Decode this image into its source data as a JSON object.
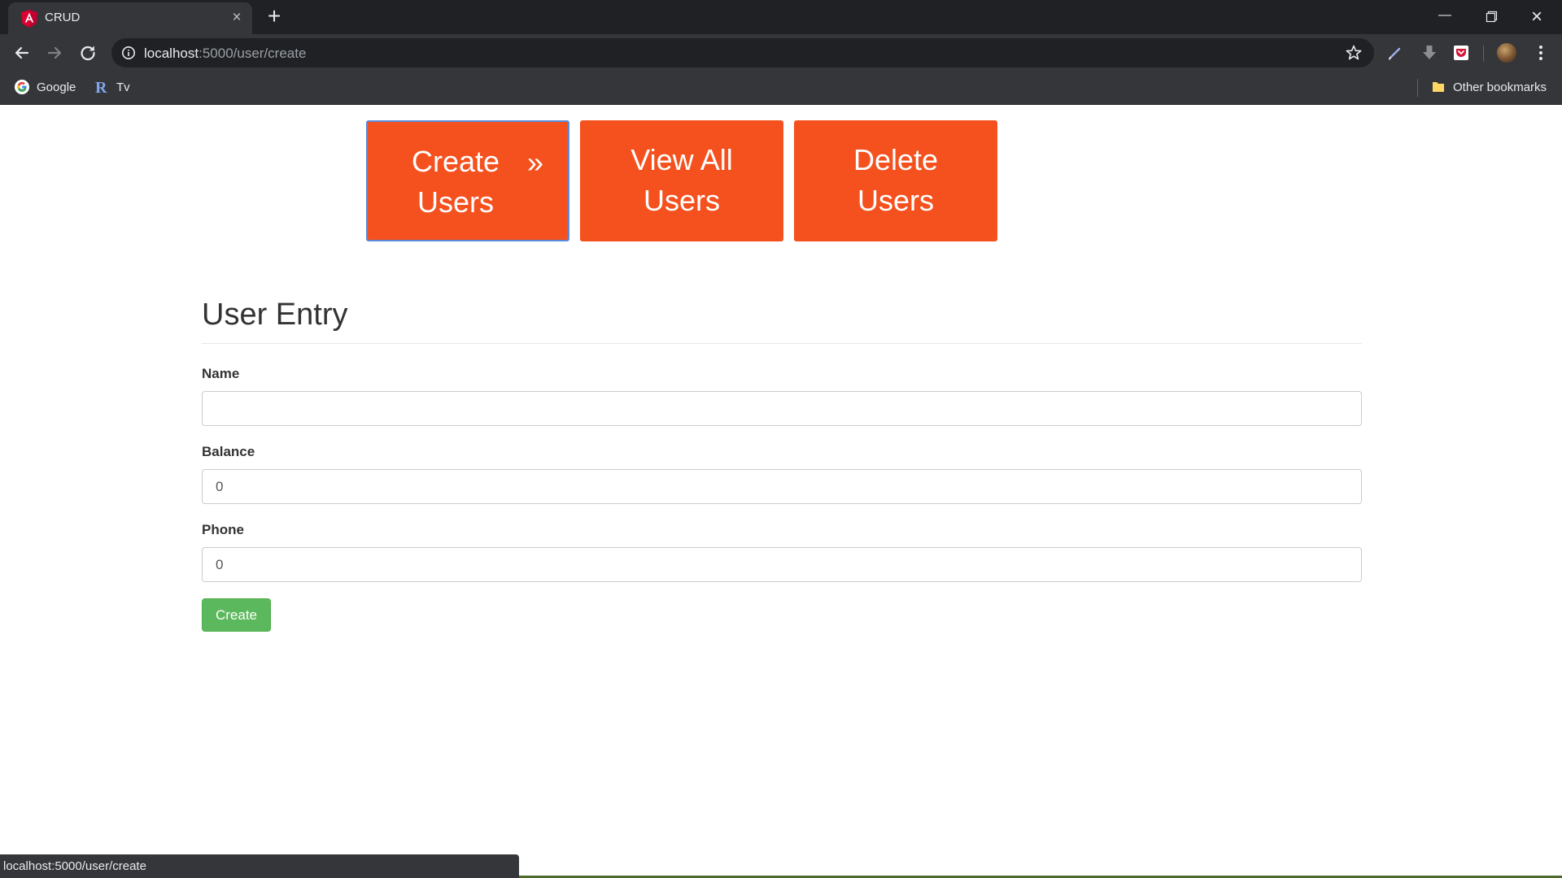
{
  "browser": {
    "tab_title": "CRUD",
    "url_host": "localhost",
    "url_rest": ":5000/user/create",
    "bookmarks": [
      "Google",
      "Tv"
    ],
    "other_bookmarks": "Other bookmarks",
    "status_url": "localhost:5000/user/create"
  },
  "nav": {
    "create_line1": "Create",
    "create_line2": "Users",
    "create_chevron": "»",
    "view_line1": "View All",
    "view_line2": "Users",
    "delete_line1": "Delete",
    "delete_line2": "Users"
  },
  "form": {
    "title": "User Entry",
    "name_label": "Name",
    "name_value": "",
    "balance_label": "Balance",
    "balance_value": "0",
    "phone_label": "Phone",
    "phone_value": "0",
    "submit_label": "Create"
  },
  "colors": {
    "nav_button": "#f4511e",
    "submit_button": "#5cb85c",
    "active_outline": "#5b8bd9",
    "chrome_dark": "#202124",
    "chrome_toolbar": "#35363a"
  },
  "icons": [
    "angular-logo-icon",
    "close-icon",
    "plus-icon",
    "minimize-icon",
    "restore-icon",
    "back-arrow-icon",
    "forward-arrow-icon",
    "reload-icon",
    "info-icon",
    "star-icon",
    "pen-icon",
    "download-icon",
    "pocket-icon",
    "avatar",
    "kebab-menu-icon",
    "google-logo-icon",
    "r-logo-icon",
    "folder-icon"
  ]
}
